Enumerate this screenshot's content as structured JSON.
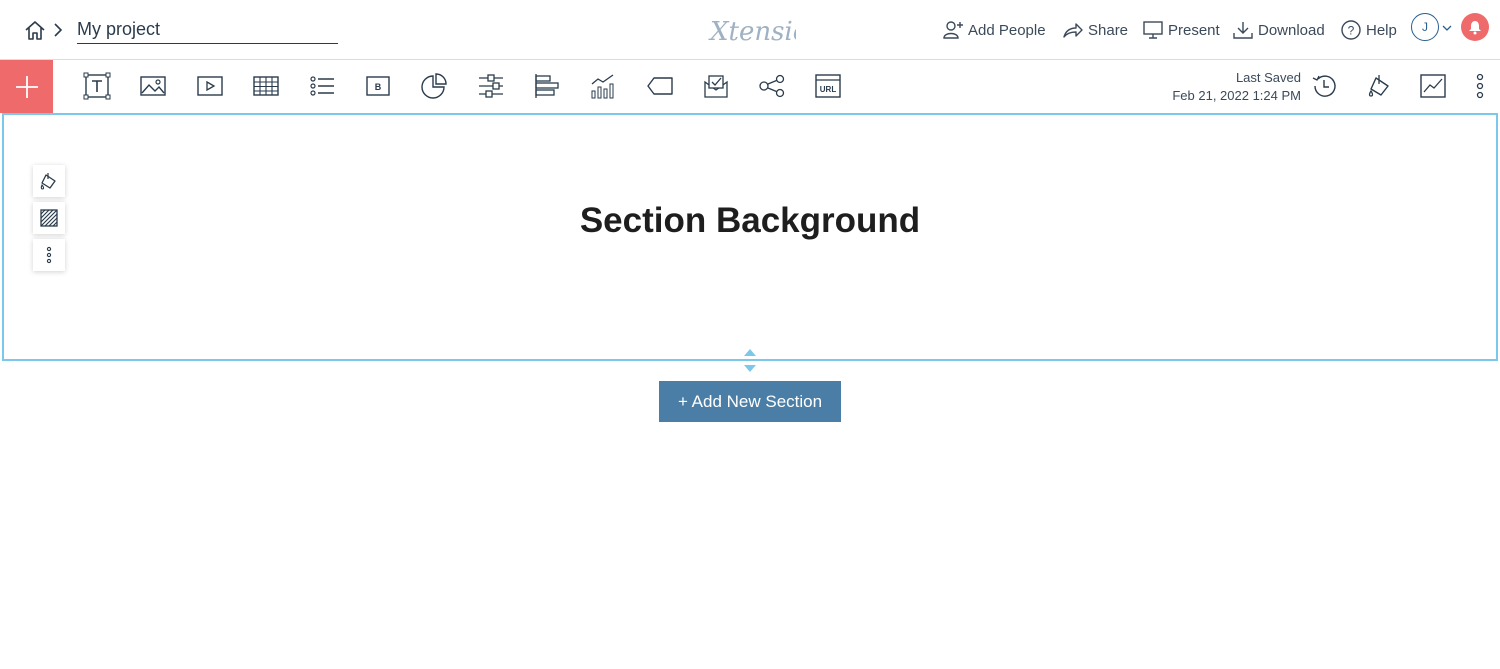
{
  "header": {
    "project_name": "My project",
    "logo_text": "Xtensio",
    "add_people": "Add People",
    "share": "Share",
    "present": "Present",
    "download": "Download",
    "help": "Help",
    "avatar_initial": "J"
  },
  "toolbar": {
    "icons": [
      "add-block-icon",
      "text-icon",
      "image-icon",
      "video-icon",
      "table-icon",
      "list-icon",
      "button-icon",
      "pie-chart-icon",
      "slider-icon",
      "bar-chart-icon",
      "line-chart-icon",
      "tag-icon",
      "form-icon",
      "share-nodes-icon",
      "url-embed-icon"
    ],
    "last_saved_label": "Last Saved",
    "last_saved_time": "Feb 21, 2022 1:24 PM"
  },
  "section": {
    "title": "Section Background"
  },
  "add_section_label": "+ Add New Section",
  "colors": {
    "accent_red": "#ef6b6b",
    "section_border": "#7cc8ec",
    "button_blue": "#4a7ea6",
    "ink": "#2a3b4c"
  }
}
